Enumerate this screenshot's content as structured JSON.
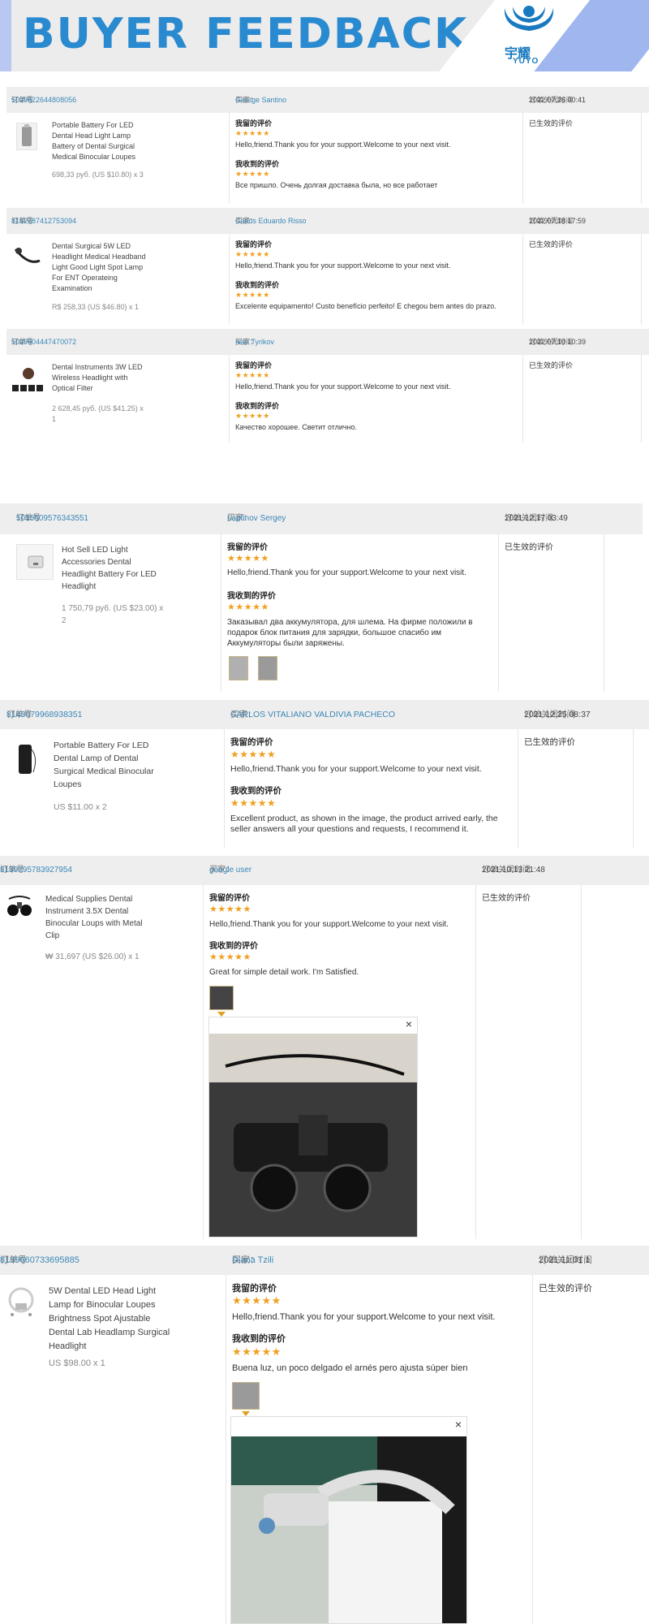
{
  "banner": {
    "title": "BUYER FEEDBACK",
    "brand_cn": "宇耀",
    "brand_en": "YUYO"
  },
  "labels": {
    "order": "订单号",
    "buyer": "买家：",
    "closed": "订单关闭时间",
    "my_review": "我留的评价",
    "received_review": "我收到的评价",
    "status": "已生效的评价",
    "stars": "★★★★★",
    "reply": "Hello,friend.Thank you for your support.Welcome to your next visit.",
    "close": "×"
  },
  "orders": [
    {
      "id": "5029822644808056",
      "buyer": "George Santino",
      "time": "2022.07.26 00:41",
      "product": "Portable Battery For LED Dental Head Light Lamp Battery of Dental Surgical Medical Binocular Loupes",
      "price": "698,33 руб. (US $10.80) x 3",
      "review": "Все пришло. Очень долгая доставка была, но все работает"
    },
    {
      "id": "8152287412753094",
      "buyer": "Carlos Eduardo Risso",
      "time": "2022.07.18 17:59",
      "product": "Dental Surgical 5W LED Headlight Medical Headband Light Good Light Spot Lamp For ENT Operateing Examination",
      "price": "R$ 258,33 (US $46.80) x 1",
      "review": "Excelente equipamento! Custo benefício perfeito! E chegou bem antes do prazo."
    },
    {
      "id": "5029904447470072",
      "buyer": "Ivan Tyrikov",
      "time": "2022.07.10 10:39",
      "product": "Dental Instruments 3W LED Wireless Headlight with Optical Filter",
      "price": "2 628,45 руб. (US $41.25) x 1",
      "review": "Качество хорошее. Светит отлично."
    },
    {
      "id": "5015509576343551",
      "buyer": "Laptinov Sergey",
      "time": "2021.12.17 03:49",
      "product": "Hot Sell LED Light Accessories Dental Headlight Battery For LED Headlight",
      "price": "1 750,79 руб. (US $23.00) x 2",
      "review": "Заказывал два аккумулятора, для шлема. На фирме положили в подарок блок питания для зарядки, большое спасибо им Аккумуляторы были заряжены."
    },
    {
      "id": "8143079968938351",
      "buyer": "CARLOS VITALIANO VALDIVIA PACHECO",
      "time": "2021.12.25 08:37",
      "product": "Portable Battery For LED Dental Lamp of Dental Surgical Medical Binocular Loupes",
      "price": "US $11.00 x 2",
      "review": "Excellent product, as shown in the image, the product arrived early, the seller answers all your questions and requests, I recommend it."
    },
    {
      "id": "8139295783927954",
      "buyer": "google user",
      "time": "2021.10.13 21:48",
      "product": "Medical Supplies Dental Instrument 3.5X Dental Binocular Loups with Metal Clip",
      "price": "₩ 31,697 (US $26.00) x 1",
      "review": "Great for simple detail work. I'm Satisfied."
    },
    {
      "id": "8139660733695885",
      "buyer": "Diana Tzili",
      "time": "2021.11.01 1",
      "product": "5W Dental LED Head Light Lamp for Binocular Loupes Brightness Spot Ajustable Dental Lab Headlamp Surgical Headlight",
      "price": "US $98.00 x 1",
      "review": "Buena luz, un poco delgado el arnés pero ajusta súper bien"
    }
  ]
}
